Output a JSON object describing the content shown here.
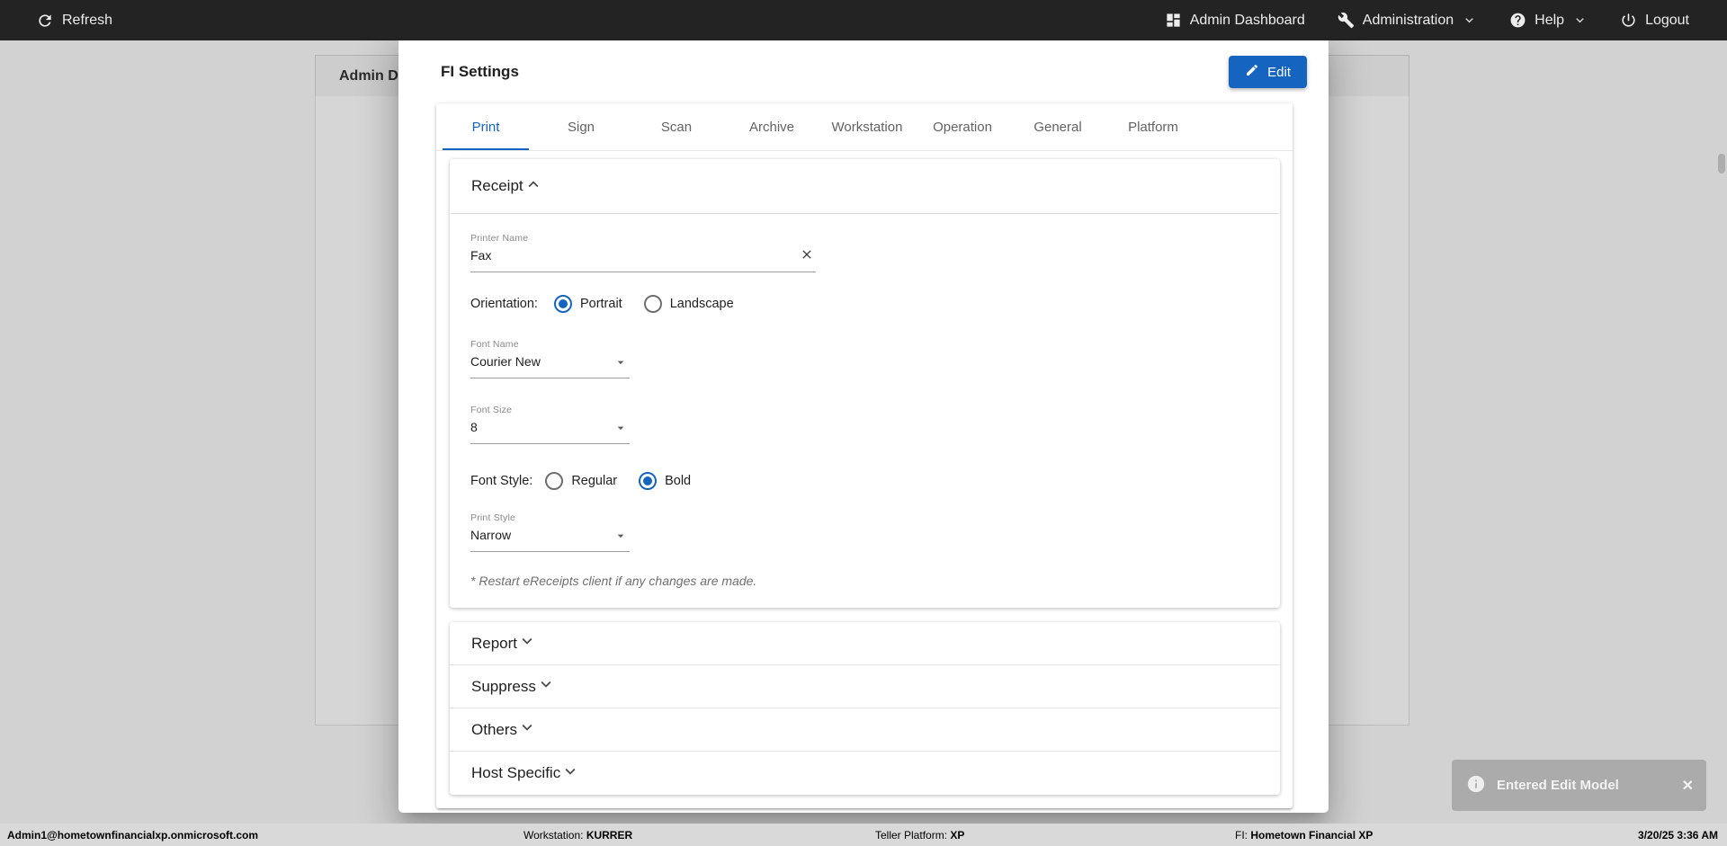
{
  "topbar": {
    "refresh": "Refresh",
    "admin_dashboard": "Admin Dashboard",
    "administration": "Administration",
    "help": "Help",
    "logout": "Logout"
  },
  "background": {
    "page_title_partial": "Admin D"
  },
  "modal": {
    "title": "FI Settings",
    "edit_button": "Edit",
    "tabs": [
      {
        "label": "Print",
        "active": true
      },
      {
        "label": "Sign",
        "active": false
      },
      {
        "label": "Scan",
        "active": false
      },
      {
        "label": "Archive",
        "active": false
      },
      {
        "label": "Workstation",
        "active": false
      },
      {
        "label": "Operation",
        "active": false
      },
      {
        "label": "General",
        "active": false
      },
      {
        "label": "Platform",
        "active": false
      }
    ],
    "receipt": {
      "title": "Receipt",
      "printer_name_label": "Printer Name",
      "printer_name_value": "Fax",
      "orientation_label": "Orientation:",
      "orientation_options": [
        "Portrait",
        "Landscape"
      ],
      "orientation_selected": "Portrait",
      "font_name_label": "Font Name",
      "font_name_value": "Courier New",
      "font_size_label": "Font Size",
      "font_size_value": "8",
      "font_style_label": "Font Style:",
      "font_style_options": [
        "Regular",
        "Bold"
      ],
      "font_style_selected": "Bold",
      "print_style_label": "Print Style",
      "print_style_value": "Narrow",
      "note": "* Restart eReceipts client if any changes are made."
    },
    "sections": [
      "Report",
      "Suppress",
      "Others",
      "Host Specific"
    ]
  },
  "statusbar": {
    "user": "Admin1@hometownfinancialxp.onmicrosoft.com",
    "workstation_label": "Workstation:",
    "workstation_value": "KURRER",
    "teller_platform_label": "Teller Platform:",
    "teller_platform_value": "XP",
    "fi_label": "FI:",
    "fi_value": "Hometown Financial XP",
    "datetime": "3/20/25 3:36 AM"
  },
  "toast": {
    "message": "Entered Edit Model"
  },
  "colors": {
    "accent": "#1565c0",
    "topbar_bg": "#232323",
    "page_bg": "#d2d2d2"
  }
}
